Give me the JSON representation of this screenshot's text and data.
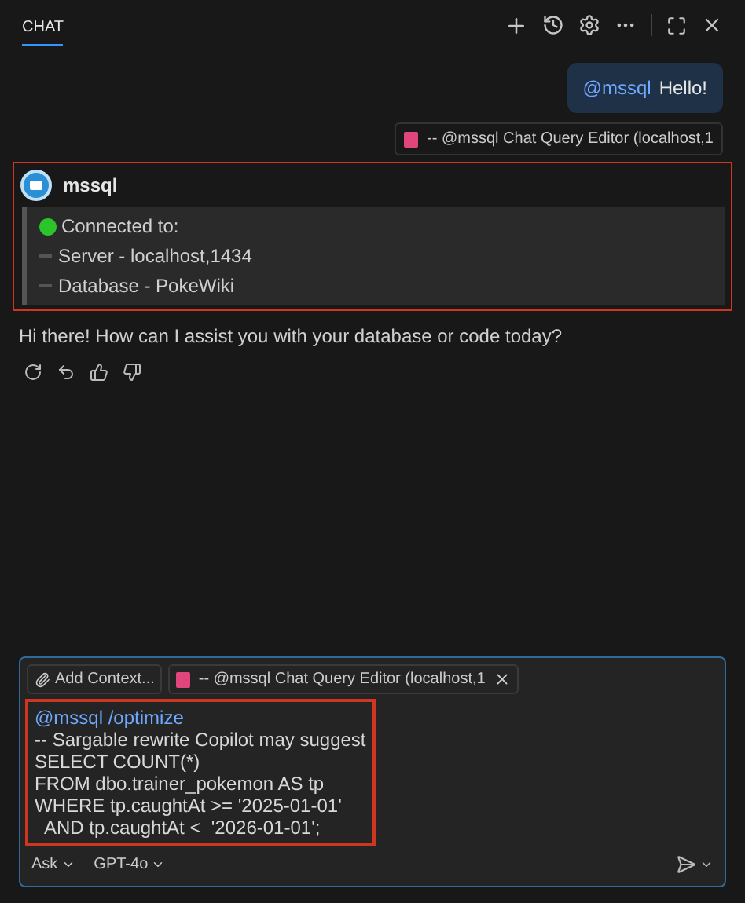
{
  "panel": {
    "tab": {
      "label": "CHAT",
      "selected": true
    }
  },
  "user_message": {
    "mention": "@mssql",
    "text": "Hello!",
    "reference": "-- @mssql Chat Query Editor (localhost,1"
  },
  "response": {
    "agent": "mssql",
    "highlighted": true,
    "status": {
      "title": "Connected to:",
      "items": [
        "Server - localhost,1434",
        "Database - PokeWiki"
      ]
    },
    "text": "Hi there! How can I assist you with your database or code today?"
  },
  "input": {
    "add_context": "Add Context...",
    "attachment": "-- @mssql Chat Query Editor (localhost,1",
    "highlighted": true,
    "command": "@mssql /optimize",
    "lines": [
      "-- Sargable rewrite Copilot may suggest",
      "SELECT COUNT(*)",
      "FROM dbo.trainer_pokemon AS tp",
      "WHERE tp.caughtAt >= '2025-01-01'",
      "  AND tp.caughtAt <  '2026-01-01';"
    ],
    "mode": "Ask",
    "model": "GPT-4o"
  }
}
